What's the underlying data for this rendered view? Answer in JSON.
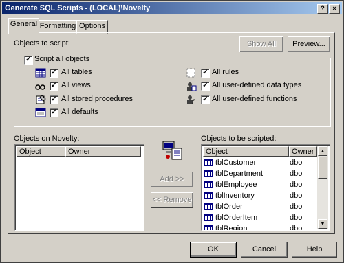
{
  "window": {
    "title": "Generate SQL Scripts - (LOCAL)\\Novelty"
  },
  "tabs": [
    {
      "label": "General"
    },
    {
      "label": "Formatting"
    },
    {
      "label": "Options"
    }
  ],
  "general": {
    "objects_to_script_label": "Objects to script:",
    "show_all_label": "Show All",
    "preview_label": "Preview...",
    "script_all_label": "Script all objects",
    "options": [
      {
        "label": "All tables",
        "icon": "table-icon",
        "checked": true
      },
      {
        "label": "All views",
        "icon": "view-icon",
        "checked": true
      },
      {
        "label": "All stored procedures",
        "icon": "stored-procedure-icon",
        "checked": true
      },
      {
        "label": "All defaults",
        "icon": "default-icon",
        "checked": true
      },
      {
        "label": "All rules",
        "icon": "rule-icon",
        "checked": true
      },
      {
        "label": "All user-defined data types",
        "icon": "user-data-type-icon",
        "checked": true
      },
      {
        "label": "All user-defined functions",
        "icon": "user-function-icon",
        "checked": true
      }
    ],
    "objects_on_label": "Objects on Novelty:",
    "objects_to_be_scripted_label": "Objects to be scripted:",
    "left_columns": {
      "object": "Object",
      "owner": "Owner"
    },
    "right_columns": {
      "object": "Object",
      "owner": "Owner"
    },
    "add_label": "Add >>",
    "remove_label": "<< Remove",
    "scripted_rows": [
      {
        "object": "tblCustomer",
        "owner": "dbo"
      },
      {
        "object": "tblDepartment",
        "owner": "dbo"
      },
      {
        "object": "tblEmployee",
        "owner": "dbo"
      },
      {
        "object": "tblInventory",
        "owner": "dbo"
      },
      {
        "object": "tblOrder",
        "owner": "dbo"
      },
      {
        "object": "tblOrderItem",
        "owner": "dbo"
      },
      {
        "object": "tblRegion",
        "owner": "dbo"
      }
    ]
  },
  "footer": {
    "ok_label": "OK",
    "cancel_label": "Cancel",
    "help_label": "Help"
  },
  "colors": {
    "titlebar_start": "#0a246a",
    "titlebar_end": "#a6caf0",
    "face": "#d4d0c8"
  }
}
